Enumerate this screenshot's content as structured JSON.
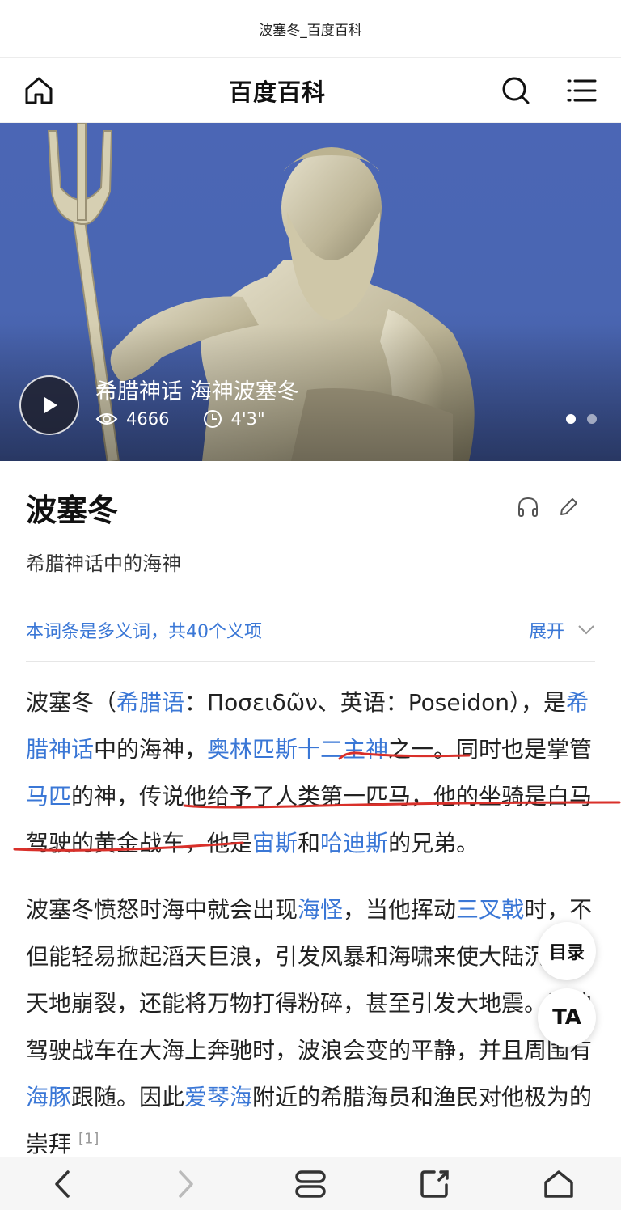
{
  "browser": {
    "page_title": "波塞冬_百度百科"
  },
  "header": {
    "brand": "百度百科"
  },
  "hero": {
    "video_title": "希腊神话 海神波塞冬",
    "views": "4666",
    "duration": "4'3\"",
    "slide_count": 2,
    "active_slide": 1
  },
  "entry": {
    "title": "波塞冬",
    "subtitle": "希腊神话中的海神"
  },
  "polysemy": {
    "text": "本词条是多义词，共40个义项",
    "expand_label": "展开"
  },
  "article": {
    "p1": {
      "t1": "波塞冬（",
      "l1": "希腊语",
      "t2": "：Ποσειδῶν、英语：Poseidon），是",
      "l2": "希腊神话",
      "t3": "中的海神，",
      "l3": "奥林匹斯十二主神",
      "t4": "之一。同时也是掌管",
      "l4": "马匹",
      "t5": "的神，传说他给予了人类第一匹马，他的坐骑是白马驾驶的黄金战车，他是",
      "l5": "宙斯",
      "t6": "和",
      "l6": "哈迪斯",
      "t7": "的兄弟。"
    },
    "p2": {
      "t1": "波塞冬愤怒时海中就会出现",
      "l1": "海怪",
      "t2": "，当他挥动",
      "l2": "三叉戟",
      "t3": "时，不但能轻易掀起滔天巨浪，引发风暴和海啸来使大陆沉没、天地崩裂，还能将万物打得粉碎，甚至引发大地震。当他驾驶战车在大海上奔驰时，波浪会变的平静，并且周围有",
      "l3": "海豚",
      "t4": "跟随。因此",
      "l4": "爱琴海",
      "t5": "附近的希腊海员和渔民对他极为的崇拜",
      "ref": "[1]"
    }
  },
  "floating": {
    "toc_label": "目录",
    "font_label": "TA"
  },
  "colors": {
    "link": "#3a77d6",
    "hero_sky": "#4a66b2",
    "annotation": "#d9302a"
  }
}
